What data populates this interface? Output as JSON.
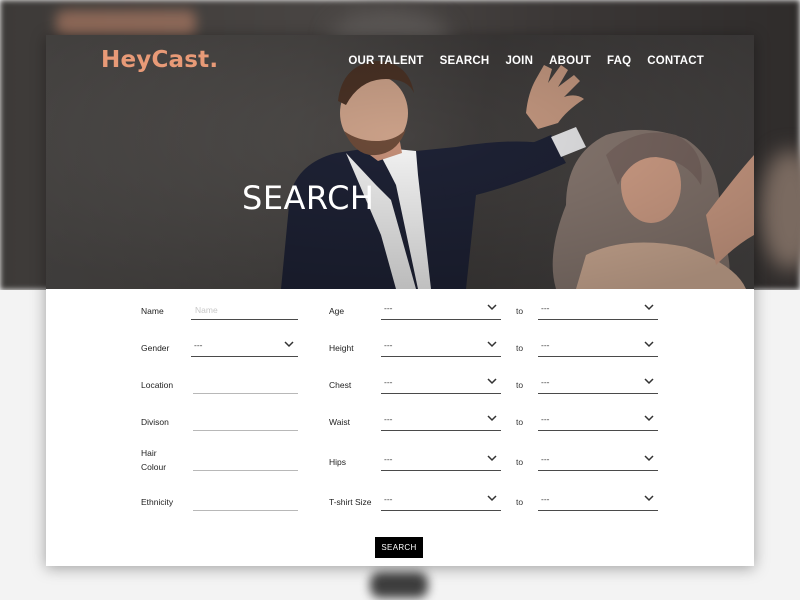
{
  "brand": {
    "logo": "HeyCast.",
    "logo_color": "#e89a77"
  },
  "nav": [
    "OUR TALENT",
    "SEARCH",
    "JOIN",
    "ABOUT",
    "FAQ",
    "CONTACT"
  ],
  "hero": {
    "title": "SEARCH"
  },
  "form": {
    "left_fields": [
      {
        "label": "Name",
        "type": "text",
        "placeholder": "Name",
        "value": ""
      },
      {
        "label": "Gender",
        "type": "select",
        "value": "---"
      },
      {
        "label": "Location",
        "type": "text",
        "placeholder": "",
        "value": ""
      },
      {
        "label": "Divison",
        "type": "text",
        "placeholder": "",
        "value": ""
      },
      {
        "label_line1": "Hair",
        "label_line2": "Colour",
        "type": "text",
        "placeholder": "",
        "value": ""
      },
      {
        "label": "Ethnicity",
        "type": "text",
        "placeholder": "",
        "value": ""
      }
    ],
    "range_fields": [
      {
        "label": "Age",
        "from": "---",
        "to_label": "to",
        "to": "---"
      },
      {
        "label": "Height",
        "from": "---",
        "to_label": "to",
        "to": "---"
      },
      {
        "label": "Chest",
        "from": "---",
        "to_label": "to",
        "to": "---"
      },
      {
        "label": "Waist",
        "from": "---",
        "to_label": "to",
        "to": "---"
      },
      {
        "label": "Hips",
        "from": "---",
        "to_label": "to",
        "to": "---"
      },
      {
        "label": "T-shirt Size",
        "from": "---",
        "to_label": "to",
        "to": "---"
      }
    ],
    "submit_label": "SEARCH"
  }
}
